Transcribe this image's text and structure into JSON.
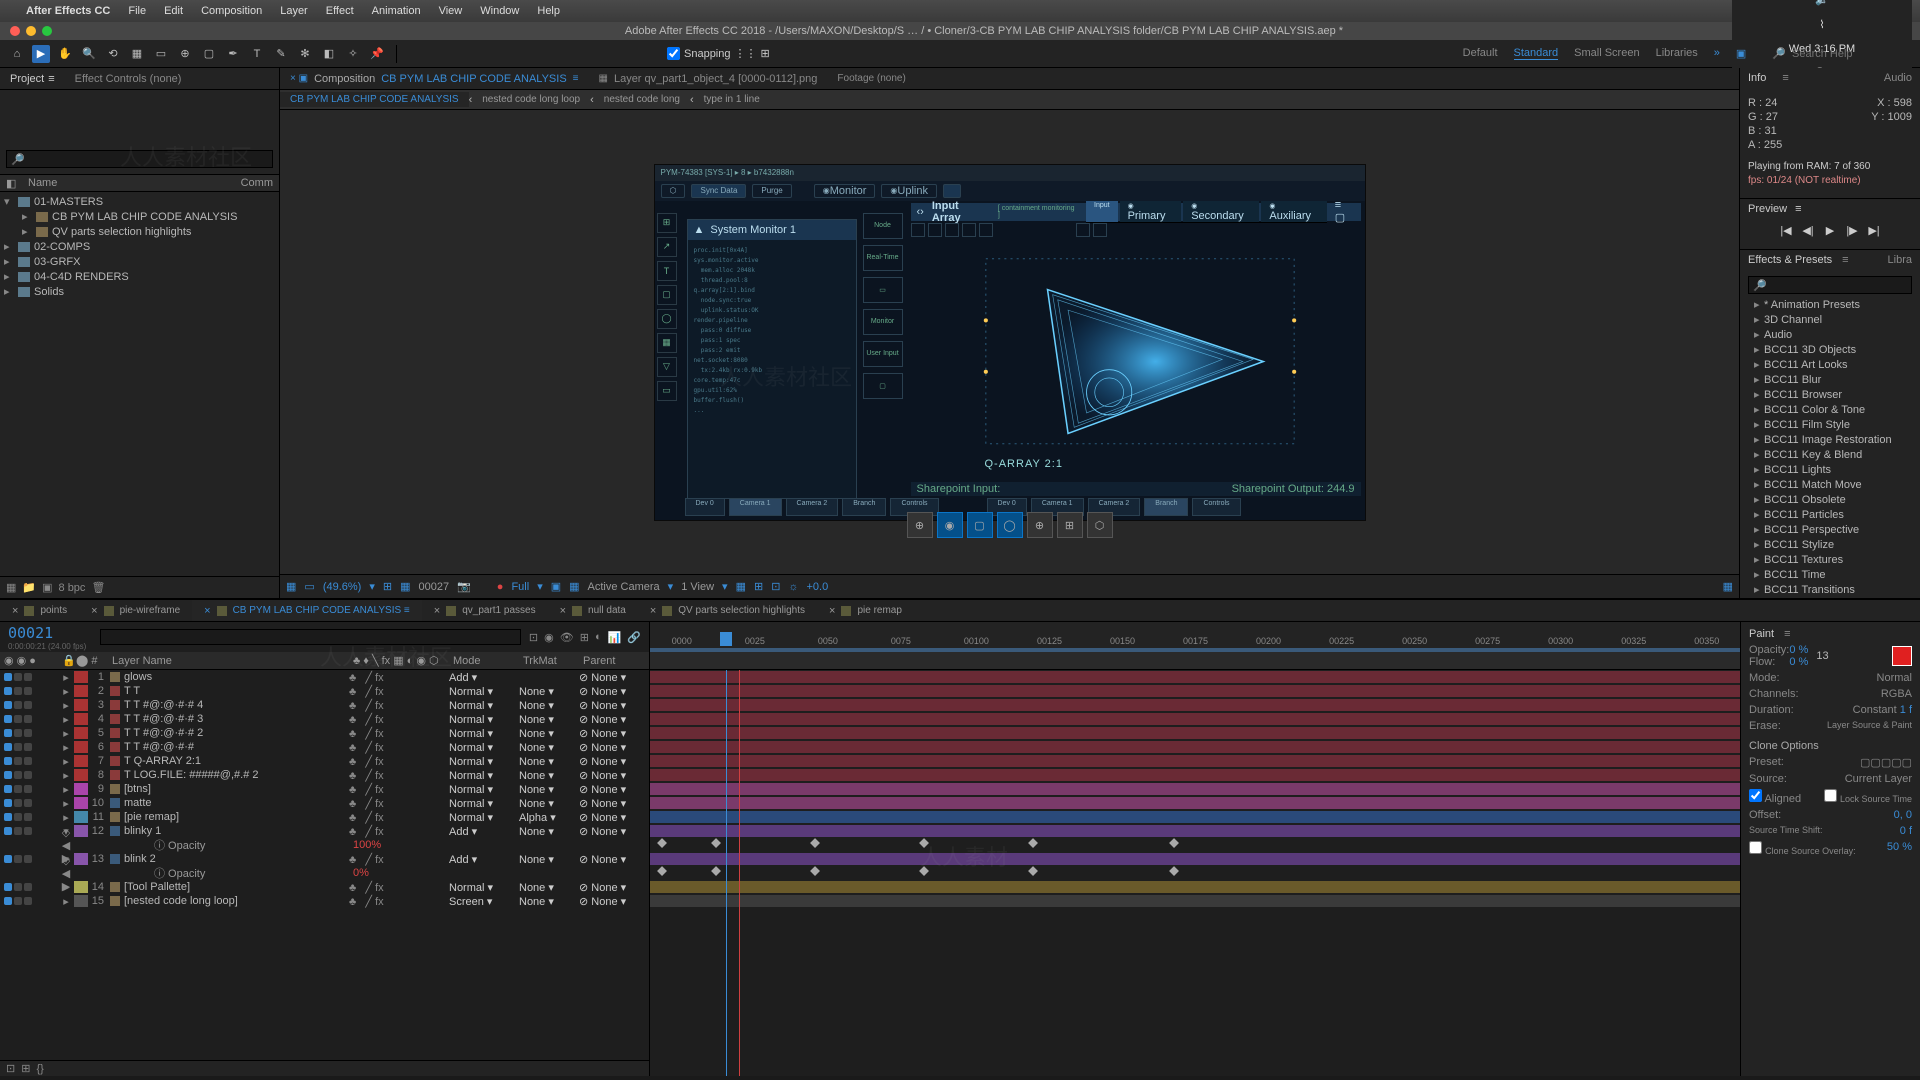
{
  "menubar": {
    "app": "After Effects CC",
    "items": [
      "File",
      "Edit",
      "Composition",
      "Layer",
      "Effect",
      "Animation",
      "View",
      "Window",
      "Help"
    ],
    "clock": "Wed 3:16 PM"
  },
  "titlebar": "Adobe After Effects CC 2018 - /Users/MAXON/Desktop/S … / • Cloner/3-CB PYM LAB CHIP ANALYSIS folder/CB PYM LAB CHIP ANALYSIS.aep *",
  "toolbar": {
    "snapping": "Snapping",
    "workspaces": [
      "Default",
      "Standard",
      "Small Screen",
      "Libraries"
    ],
    "search_ph": "Search Help"
  },
  "project": {
    "tab1": "Project",
    "tab2": "Effect Controls (none)",
    "col_name": "Name",
    "col_comm": "Comm",
    "tree": [
      {
        "t": "f",
        "l": "01-MASTERS",
        "open": true
      },
      {
        "t": "c",
        "l": "CB PYM LAB CHIP CODE ANALYSIS",
        "ind": 1
      },
      {
        "t": "c",
        "l": "QV parts selection highlights",
        "ind": 1
      },
      {
        "t": "f",
        "l": "02-COMPS"
      },
      {
        "t": "f",
        "l": "03-GRFX"
      },
      {
        "t": "f",
        "l": "04-C4D RENDERS"
      },
      {
        "t": "f",
        "l": "Solids"
      }
    ],
    "bpc": "8 bpc"
  },
  "comp": {
    "tab_prefix": "Composition",
    "tab_name": "CB PYM LAB CHIP CODE ANALYSIS",
    "layer_tab": "Layer qv_part1_object_4 [0000-0112].png",
    "footage_tab": "Footage (none)",
    "flow": [
      "CB PYM LAB CHIP CODE ANALYSIS",
      "nested code long loop",
      "nested code long",
      "type in 1 line"
    ],
    "viewport": {
      "topstrip": "PYM-74383 [SYS-1] ▸ 8 ▸ b7432888n",
      "chips": [
        "Sync Data",
        "Purge",
        "Monitor",
        "Uplink"
      ],
      "sysmon_title": "System Monitor 1",
      "input_title": "Input Array",
      "input_sub": "[ containment monitoring ]",
      "input_tabs": [
        "Input",
        "Primary",
        "Secondary",
        "Auxiliary"
      ],
      "mid_buttons": [
        "Node",
        "Real-Time",
        "Monitor",
        "User Input"
      ],
      "bottom_tabs_left": [
        "Dev 0",
        "Camera 1",
        "Camera 2",
        "Branch",
        "Controls"
      ],
      "bottom_tabs_right": [
        "Dev 0",
        "Camera 1",
        "Camera 2",
        "Branch",
        "Controls"
      ],
      "strip_left": "Sharepoint Input:",
      "strip_right": "Sharepoint Output: 244.9",
      "qarray": "Q-ARRAY 2:1"
    },
    "viewer_bar": {
      "zoom": "(49.6%)",
      "timecode": "00027",
      "res": "Full",
      "camera": "Active Camera",
      "view": "1 View",
      "exp": "+0.0"
    }
  },
  "info": {
    "tab_info": "Info",
    "tab_audio": "Audio",
    "r": "R :   24",
    "x": "X :   598",
    "g": "G :   27",
    "y": "Y :   1009",
    "b": "B :   31",
    "a": "A :   255",
    "ram": "Playing from RAM: 7 of 360",
    "fps": "fps: 01/24 (NOT realtime)"
  },
  "preview": {
    "title": "Preview"
  },
  "effects_presets": {
    "title": "Effects & Presets",
    "lib": "Libra",
    "items": [
      "* Animation Presets",
      "3D Channel",
      "Audio",
      "BCC11 3D Objects",
      "BCC11 Art Looks",
      "BCC11 Blur",
      "BCC11 Browser",
      "BCC11 Color & Tone",
      "BCC11 Film Style",
      "BCC11 Image Restoration",
      "BCC11 Key & Blend",
      "BCC11 Lights",
      "BCC11 Match Move",
      "BCC11 Obsolete",
      "BCC11 Particles",
      "BCC11 Perspective",
      "BCC11 Stylize",
      "BCC11 Textures",
      "BCC11 Time",
      "BCC11 Transitions"
    ]
  },
  "timeline": {
    "tabs": [
      {
        "l": "points"
      },
      {
        "l": "pie-wireframe"
      },
      {
        "l": "CB PYM LAB CHIP CODE ANALYSIS",
        "a": true
      },
      {
        "l": "qv_part1 passes"
      },
      {
        "l": "null data"
      },
      {
        "l": "QV parts selection highlights"
      },
      {
        "l": "pie remap"
      }
    ],
    "timecode": "00021",
    "timecode_sub": "0:00:00:21 (24.00 fps)",
    "col_layer": "Layer Name",
    "col_mode": "Mode",
    "col_trk": "TrkMat",
    "col_parent": "Parent",
    "ticks": [
      "0000",
      "0025",
      "0050",
      "0075",
      "00100",
      "00125",
      "00150",
      "00175",
      "00200",
      "00225",
      "00250",
      "00275",
      "00300",
      "00325",
      "00350"
    ],
    "layers": [
      {
        "n": 1,
        "name": "glows",
        "t": "comp",
        "mode": "Add",
        "trk": "",
        "par": "None",
        "c": "c-red",
        "lc": "#a33"
      },
      {
        "n": 2,
        "name": "T",
        "t": "txt",
        "mode": "Normal",
        "trk": "None",
        "par": "None",
        "c": "c-red",
        "lc": "#a33"
      },
      {
        "n": 3,
        "name": "T  #@:@·#·# 4",
        "t": "txt",
        "mode": "Normal",
        "trk": "None",
        "par": "None",
        "c": "c-red",
        "lc": "#a33"
      },
      {
        "n": 4,
        "name": "T  #@:@·#·# 3",
        "t": "txt",
        "mode": "Normal",
        "trk": "None",
        "par": "None",
        "c": "c-red",
        "lc": "#a33"
      },
      {
        "n": 5,
        "name": "T  #@:@·#·# 2",
        "t": "txt",
        "mode": "Normal",
        "trk": "None",
        "par": "None",
        "c": "c-red",
        "lc": "#a33"
      },
      {
        "n": 6,
        "name": "T  #@:@·#·#",
        "t": "txt",
        "mode": "Normal",
        "trk": "None",
        "par": "None",
        "c": "c-red",
        "lc": "#a33"
      },
      {
        "n": 7,
        "name": "Q-ARRAY 2:1",
        "t": "txt",
        "mode": "Normal",
        "trk": "None",
        "par": "None",
        "c": "c-red",
        "lc": "#a33"
      },
      {
        "n": 8,
        "name": "LOG.FILE: #####@,#.# 2",
        "t": "txt",
        "mode": "Normal",
        "trk": "None",
        "par": "None",
        "c": "c-red",
        "lc": "#a33"
      },
      {
        "n": 9,
        "name": "[btns]",
        "t": "comp",
        "mode": "Normal",
        "trk": "None",
        "par": "None",
        "c": "c-mag",
        "lc": "#a4a"
      },
      {
        "n": 10,
        "name": "matte",
        "t": "sq",
        "mode": "Normal",
        "trk": "None",
        "par": "None",
        "c": "c-mag",
        "lc": "#a4a"
      },
      {
        "n": 11,
        "name": "[pie remap]",
        "t": "comp",
        "mode": "Normal",
        "trk": "Alpha",
        "par": "None",
        "c": "c-blue",
        "lc": "#48a"
      },
      {
        "n": 12,
        "name": "blinky 1",
        "t": "sq",
        "mode": "Add",
        "trk": "None",
        "par": "None",
        "c": "c-pur",
        "lc": "#85a",
        "open": true
      },
      {
        "sub": true,
        "name": "Opacity",
        "val": "100%"
      },
      {
        "n": 13,
        "name": "blink 2",
        "t": "sq",
        "mode": "Add",
        "trk": "None",
        "par": "None",
        "c": "c-pur",
        "lc": "#85a",
        "open": true
      },
      {
        "sub": true,
        "name": "Opacity",
        "val": "0%"
      },
      {
        "n": 14,
        "name": "[Tool Pallette]",
        "t": "comp",
        "mode": "Normal",
        "trk": "None",
        "par": "None",
        "c": "c-yel",
        "lc": "#aa5"
      },
      {
        "n": 15,
        "name": "[nested code long loop]",
        "t": "comp",
        "mode": "Screen",
        "trk": "None",
        "par": "None",
        "c": "c-grey",
        "lc": "#555"
      }
    ]
  },
  "paint": {
    "title": "Paint",
    "opacity": {
      "l": "Opacity:",
      "v": "0 %"
    },
    "flow": {
      "l": "Flow:",
      "v": "0 %"
    },
    "pxval": "13",
    "mode": {
      "l": "Mode:",
      "v": "Normal"
    },
    "channels": {
      "l": "Channels:",
      "v": "RGBA"
    },
    "duration": {
      "l": "Duration:",
      "v": "Constant",
      "n": "1  f"
    },
    "erase": {
      "l": "Erase:",
      "v": "Layer Source & Paint"
    },
    "clone": "Clone Options",
    "preset": "Preset:",
    "source": {
      "l": "Source:",
      "v": "Current Layer"
    },
    "aligned": "Aligned",
    "lock": "Lock Source Time",
    "offset": {
      "l": "Offset:",
      "v": "0,        0"
    },
    "sts": {
      "l": "Source Time Shift:",
      "v": "0  f"
    },
    "cso": {
      "l": "Clone Source Overlay:",
      "v": "50 %"
    }
  }
}
